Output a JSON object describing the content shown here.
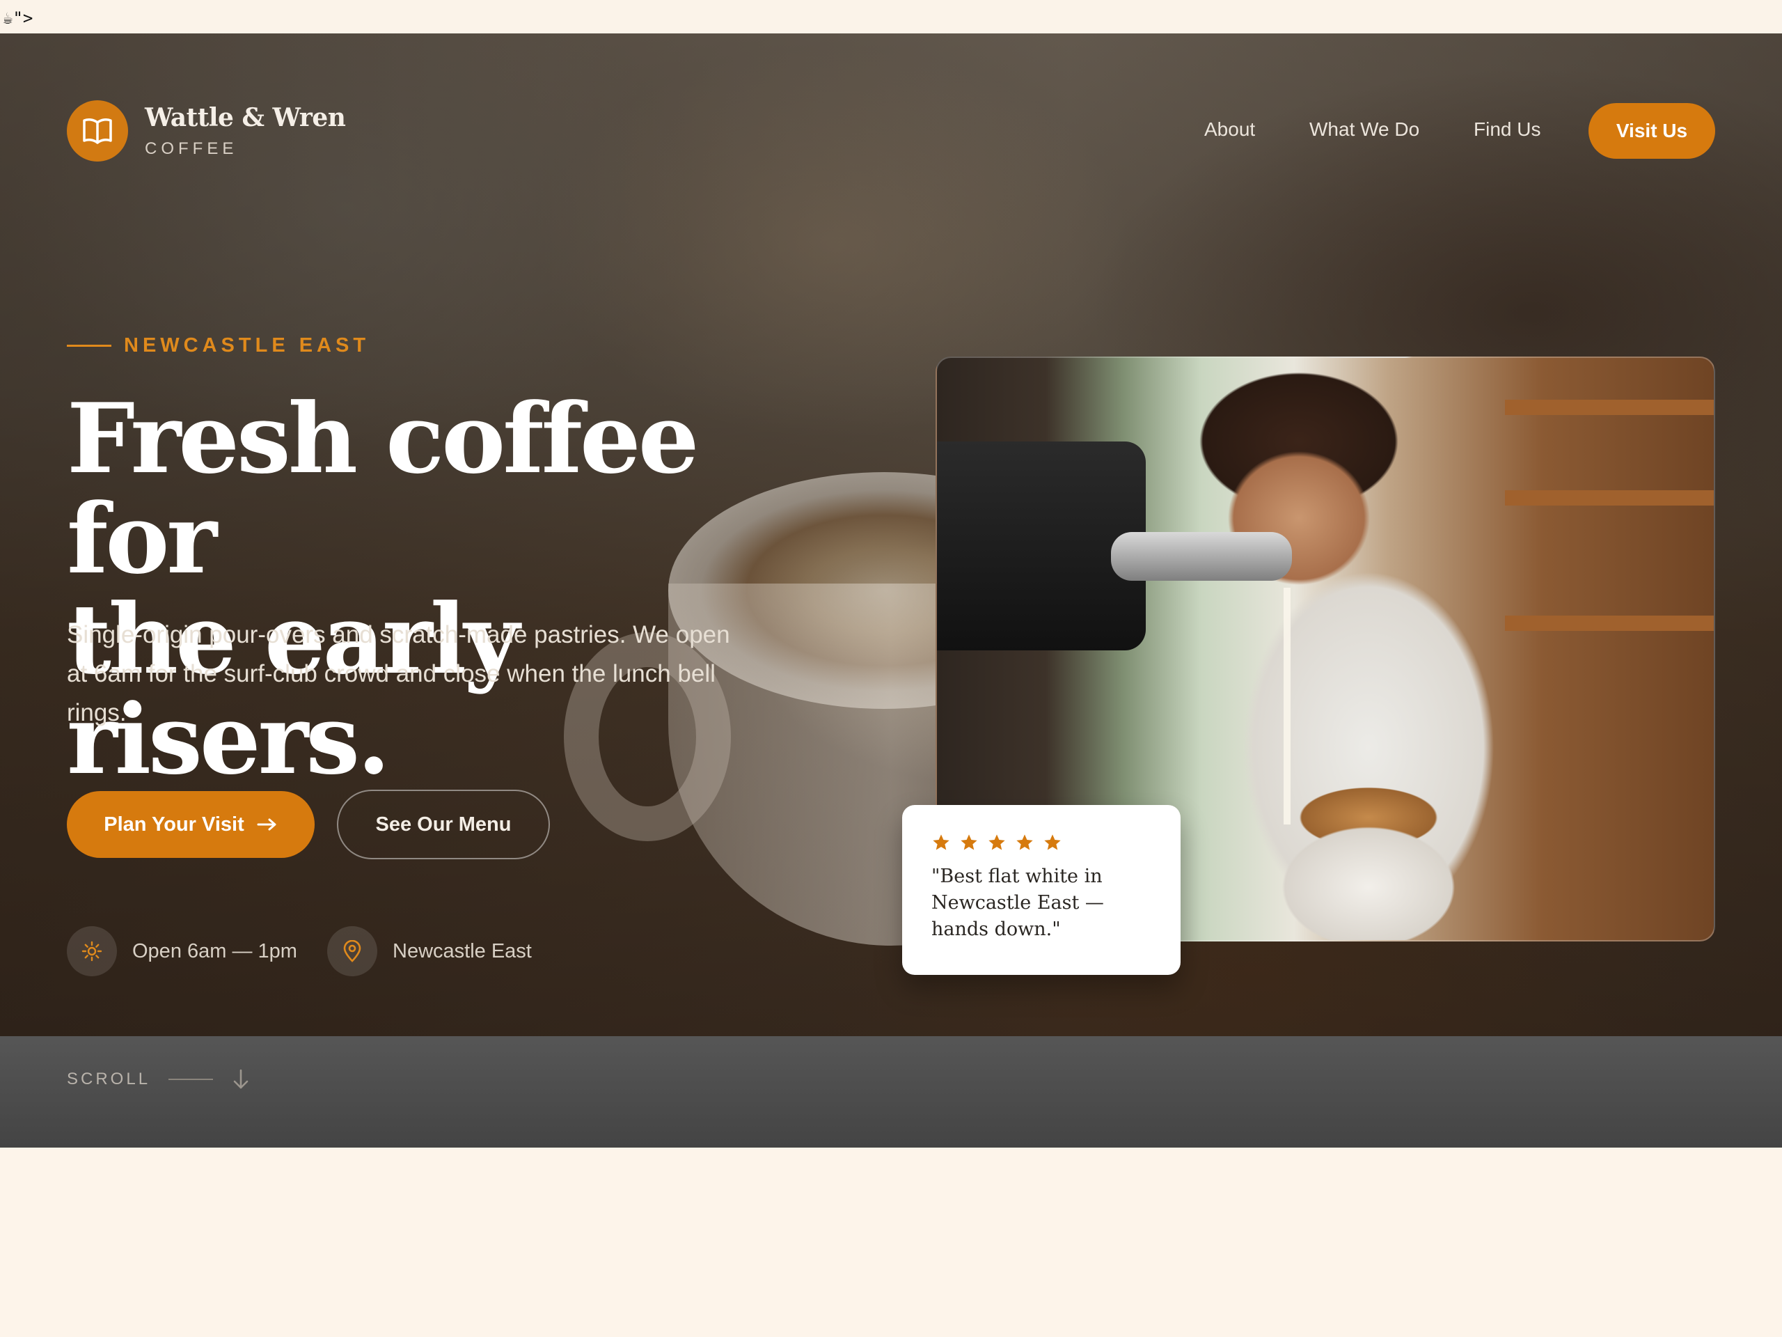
{
  "artifact_text": "☕\">",
  "brand": {
    "name": "Wattle & Wren",
    "tagline": "COFFEE",
    "logo_icon": "open-book-icon"
  },
  "nav": {
    "links": [
      "About",
      "What We Do",
      "Find Us"
    ],
    "cta": "Visit Us"
  },
  "hero": {
    "kicker": "NEWCASTLE EAST",
    "headline_line1": "Fresh coffee for",
    "headline_line2": "the early risers.",
    "lede": "Single-origin pour-overs and scratch-made pastries. We open at 6am for the surf-club crowd and close when the lunch bell rings.",
    "primary_cta": "Plan Your Visit",
    "secondary_cta": "See Our Menu",
    "meta": [
      {
        "icon": "sun-icon",
        "text": "Open 6am — 1pm"
      },
      {
        "icon": "map-pin-icon",
        "text": "Newcastle East"
      }
    ]
  },
  "review": {
    "stars": 5,
    "text": "\"Best flat white in Newcastle East — hands down.\""
  },
  "scroll": {
    "label": "SCROLL"
  },
  "colors": {
    "accent": "#d67a0e",
    "page_bg": "#fdf4ea",
    "band": "#4d4d4d"
  }
}
